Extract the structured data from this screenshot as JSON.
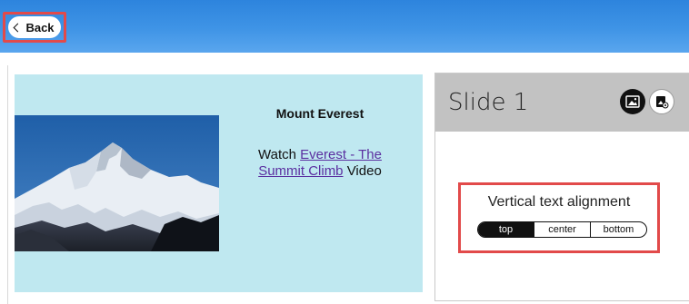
{
  "header": {
    "back_label": "Back"
  },
  "slide": {
    "title": "Mount Everest",
    "text_prefix": "Watch ",
    "link_text": "Everest - The Summit Climb",
    "text_suffix": " Video"
  },
  "panel": {
    "title": "Slide 1",
    "buttons": [
      "change-image-icon",
      "image-settings-icon"
    ],
    "vertical_alignment": {
      "label": "Vertical text alignment",
      "options": [
        "top",
        "center",
        "bottom"
      ],
      "selected": "top"
    }
  },
  "colors": {
    "header_blue": "#3f94e6",
    "highlight_red": "#e24a4a",
    "slide_background": "#bfe8f0",
    "panel_header": "#c2c2c2",
    "link": "#5b2fa0"
  }
}
